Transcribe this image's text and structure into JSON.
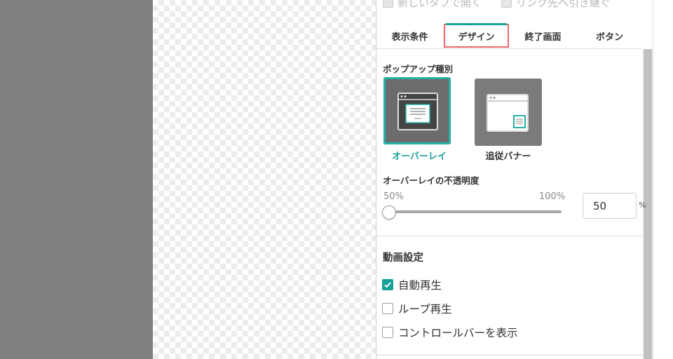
{
  "top_options": [
    {
      "label": "新しいタブで開く",
      "checked": false
    },
    {
      "label": "リンク先へ引き継ぐ",
      "checked": false
    }
  ],
  "tabs": [
    {
      "label": "表示条件",
      "active": false
    },
    {
      "label": "デザイン",
      "active": true
    },
    {
      "label": "終了画面",
      "active": false
    },
    {
      "label": "ボタン",
      "active": false
    }
  ],
  "popup_type": {
    "title": "ポップアップ種別",
    "options": [
      {
        "label": "オーバーレイ",
        "selected": true,
        "icon": "overlay-icon"
      },
      {
        "label": "追従バナー",
        "selected": false,
        "icon": "follow-banner-icon"
      }
    ]
  },
  "opacity": {
    "title": "オーバーレイの不透明度",
    "min_label": "50%",
    "max_label": "100%",
    "value": "50",
    "unit": "%",
    "slider_fraction": 0.0
  },
  "video": {
    "title": "動画設定",
    "options": [
      {
        "label": "自動再生",
        "checked": true
      },
      {
        "label": "ループ再生",
        "checked": false
      },
      {
        "label": "コントロールバーを表示",
        "checked": false
      }
    ]
  },
  "colors": {
    "accent": "#17a297",
    "highlight": "#e76a6a",
    "canvas_gray": "#808080"
  }
}
